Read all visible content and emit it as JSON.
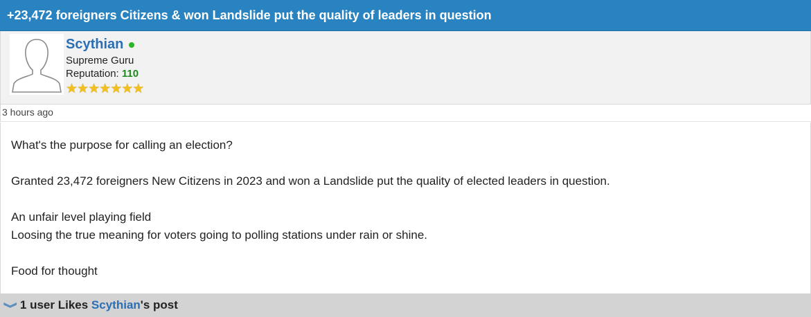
{
  "thread": {
    "title": "+23,472 foreigners Citizens & won Landslide put the quality of leaders in question"
  },
  "author": {
    "username": "Scythian",
    "user_title": "Supreme Guru",
    "reputation_label": "Reputation:",
    "reputation_value": "110",
    "stars": [
      "★",
      "★",
      "★",
      "★",
      "★",
      "★",
      "★"
    ],
    "online_color": "#2bb52b"
  },
  "post": {
    "date": "3 hours ago",
    "lines": [
      "What's the purpose for calling an election?",
      "",
      "Granted 23,472 foreigners New Citizens in 2023 and won a Landslide put the quality of elected leaders in question.",
      "",
      "An unfair level playing field",
      "Loosing the true meaning for voters going to polling stations under rain or shine.",
      "",
      "Food for thought"
    ]
  },
  "likes": {
    "icon": "chevron-down-icon",
    "prefix": "1 user Likes ",
    "user": "Scythian",
    "suffix": "'s post"
  },
  "colors": {
    "header_bg": "#2a83c1",
    "link": "#2a6fb6",
    "reputation": "#1d8a1d",
    "likes_bg": "#d3d3d3"
  }
}
